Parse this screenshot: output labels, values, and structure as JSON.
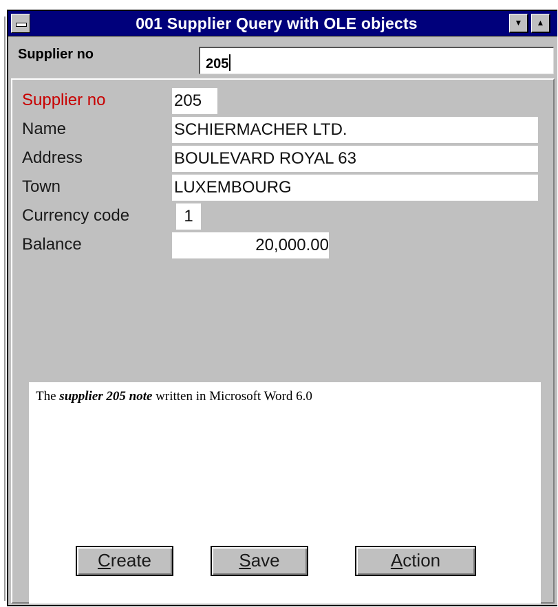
{
  "window": {
    "title": "001  Supplier Query with OLE objects",
    "menu_icon": "system-menu-icon",
    "scroll_down_icon": "scroll-down-arrow-icon",
    "scroll_up_icon": "scroll-up-arrow-icon"
  },
  "query": {
    "label": "Supplier no",
    "value": "205"
  },
  "record": {
    "supplier_no_label": "Supplier no",
    "supplier_no": "205",
    "name_label": "Name",
    "name": "SCHIERMACHER LTD.",
    "address_label": "Address",
    "address": "BOULEVARD ROYAL 63",
    "town_label": "Town",
    "town": "LUXEMBOURG",
    "currency_label": "Currency code",
    "currency": "1",
    "balance_label": "Balance",
    "balance": "20,000.00"
  },
  "ole": {
    "prefix": "The ",
    "emphasis": "supplier 205 note",
    "suffix": " written in Microsoft Word 6.0"
  },
  "buttons": {
    "create_hotkey": "C",
    "create_rest": "reate",
    "save_hotkey": "S",
    "save_rest": "ave",
    "action_hotkey": "A",
    "action_rest": "ction"
  },
  "colors": {
    "titlebar": "#00007b",
    "window_bg": "#c0c0c0",
    "highlight_label": "#c80000"
  }
}
